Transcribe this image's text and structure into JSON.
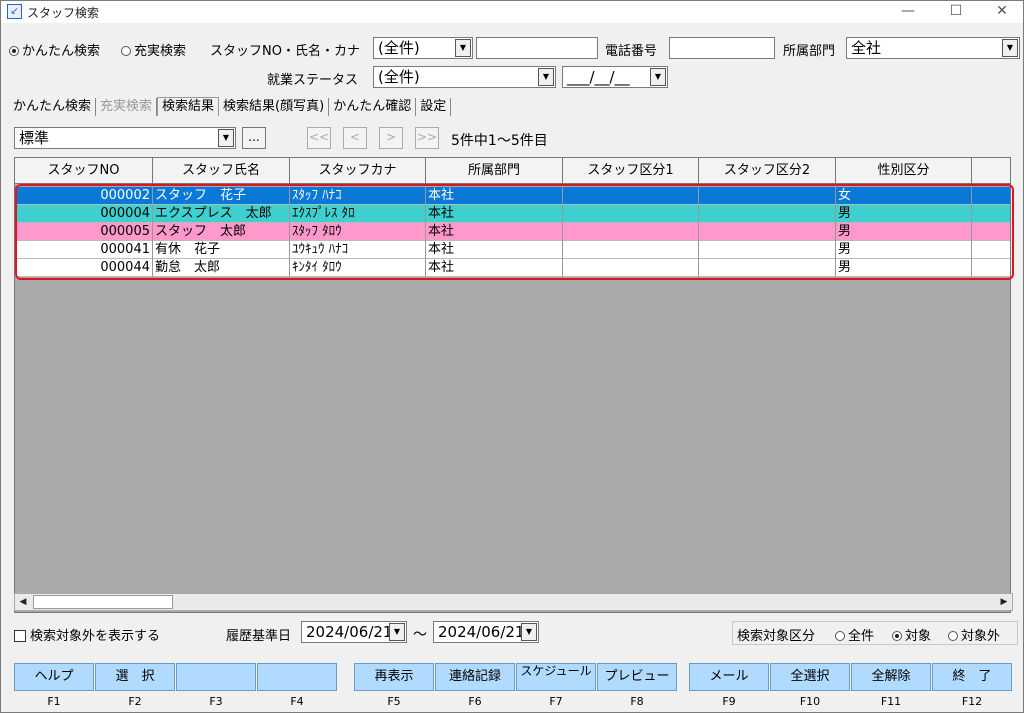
{
  "window": {
    "title": "スタッフ検索",
    "minimize_icon": "minimize-icon",
    "maximize_icon": "maximize-icon",
    "close_icon": "close-icon"
  },
  "search": {
    "mode_simple": "かんたん検索",
    "mode_full": "充実検索",
    "staff_label": "スタッフNO・氏名・カナ",
    "staff_combo": "(全件)",
    "staff_text": "",
    "phone_label": "電話番号",
    "phone_text": "",
    "dept_label": "所属部門",
    "dept_value": "全社",
    "status_label": "就業ステータス",
    "status_value": "(全件)",
    "date_value": "___/__/__"
  },
  "tabs": [
    {
      "label": "かんたん検索"
    },
    {
      "label": "充実検索"
    },
    {
      "label": "検索結果"
    },
    {
      "label": "検索結果(顔写真)"
    },
    {
      "label": "かんたん確認"
    },
    {
      "label": "設定"
    }
  ],
  "view": {
    "layout_value": "標準",
    "more_label": "...",
    "first": "<<",
    "prev": "<",
    "next": ">",
    "last": ">>",
    "count_text": "5件中1～5件目"
  },
  "grid": {
    "columns": [
      "スタッフNO",
      "スタッフ氏名",
      "スタッフカナ",
      "所属部門",
      "スタッフ区分1",
      "スタッフ区分2",
      "性別区分",
      ""
    ],
    "rows": [
      {
        "no": "000002",
        "name": "スタッフ　花子",
        "kana": "ｽﾀｯﾌ ﾊﾅｺ",
        "dept": "本社",
        "k1": "",
        "k2": "",
        "gender": "女",
        "extra": ""
      },
      {
        "no": "000004",
        "name": "エクスプレス　太郎",
        "kana": "ｴｸｽﾌﾟﾚｽ ﾀﾛ",
        "dept": "本社",
        "k1": "",
        "k2": "",
        "gender": "男",
        "extra": ""
      },
      {
        "no": "000005",
        "name": "スタッフ　太郎",
        "kana": "ｽﾀｯﾌ ﾀﾛｳ",
        "dept": "本社",
        "k1": "",
        "k2": "",
        "gender": "男",
        "extra": ""
      },
      {
        "no": "000041",
        "name": "有休　花子",
        "kana": "ﾕｳｷｭｳ ﾊﾅｺ",
        "dept": "本社",
        "k1": "",
        "k2": "",
        "gender": "男",
        "extra": ""
      },
      {
        "no": "000044",
        "name": "勤怠　太郎",
        "kana": "ｷﾝﾀｲ ﾀﾛｳ",
        "dept": "本社",
        "k1": "",
        "k2": "",
        "gender": "男",
        "extra": ""
      }
    ],
    "row_colors": [
      "#0a78d7",
      "#3ecfcf",
      "#ff99cc",
      "#ffffff",
      "#ffffff"
    ],
    "row_text_colors": [
      "#ffffff",
      "#000000",
      "#000000",
      "#000000",
      "#000000"
    ]
  },
  "footer": {
    "show_excluded": "検索対象外を表示する",
    "history_label": "履歴基準日",
    "date_from": "2024/06/21",
    "tilde": "～",
    "date_to": "2024/06/21",
    "target_label": "検索対象区分",
    "opt_all": "全件",
    "opt_target": "対象",
    "opt_excluded": "対象外"
  },
  "fkeys": [
    {
      "label": "ヘルプ",
      "key": "F1"
    },
    {
      "label": "選　択",
      "key": "F2"
    },
    {
      "label": "",
      "key": "F3"
    },
    {
      "label": "",
      "key": "F4"
    },
    {
      "label": "再表示",
      "key": "F5"
    },
    {
      "label": "連絡記録",
      "key": "F6"
    },
    {
      "label": "スケジュール",
      "key": "F7"
    },
    {
      "label": "プレビュー",
      "key": "F8"
    },
    {
      "label": "メール",
      "key": "F9"
    },
    {
      "label": "全選択",
      "key": "F10"
    },
    {
      "label": "全解除",
      "key": "F11"
    },
    {
      "label": "終　了",
      "key": "F12"
    }
  ],
  "colors": {
    "fkey_bg": "#b0dbff",
    "highlight_border": "#e0141e",
    "grid_bg": "#aaaaaa"
  }
}
